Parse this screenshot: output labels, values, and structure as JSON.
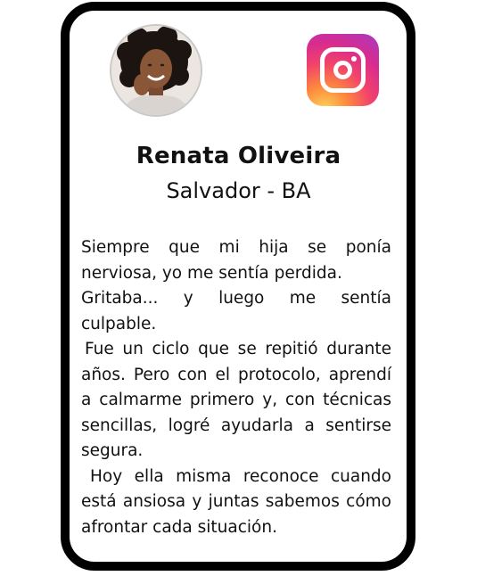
{
  "profile": {
    "name": "Renata Oliveira",
    "location": "Salvador - BA"
  },
  "social": {
    "icon": "instagram-icon",
    "brand_colors": [
      "#fdd65c",
      "#fd8a3c",
      "#f2426b",
      "#d82b8f",
      "#a53cc4"
    ]
  },
  "testimonial": {
    "paragraphs": [
      "Siempre que mi hija se ponía nerviosa, yo me sentía perdida.",
      "Gritaba... y luego me sentía culpable.",
      "Fue un ciclo que se repitió durante años. Pero con el protocolo, aprendí a calmarme primero y, con técnicas sencillas, logré ayudarla a sentirse segura.",
      "Hoy ella misma reconoce cuando está ansiosa y juntas sabemos cómo afrontar cada situación."
    ]
  }
}
